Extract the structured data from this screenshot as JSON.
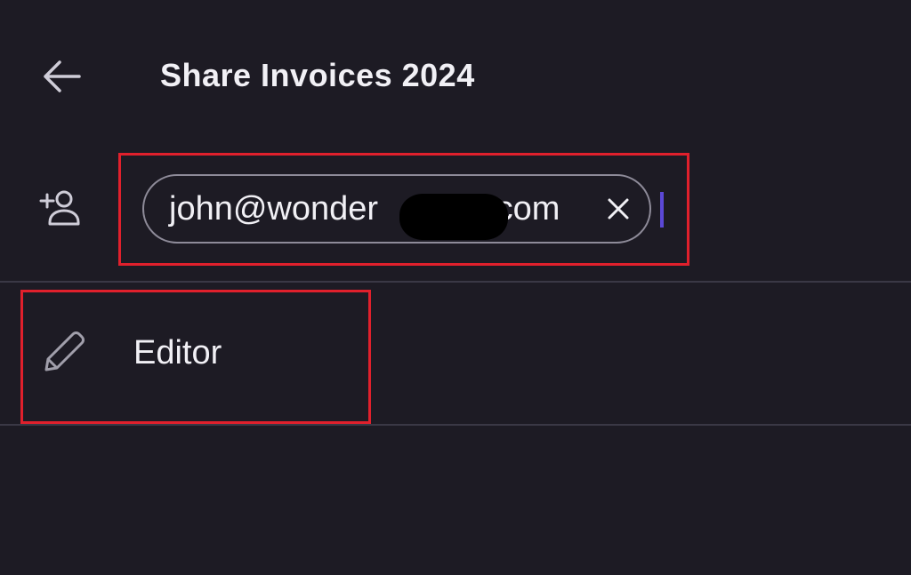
{
  "header": {
    "title": "Share Invoices 2024",
    "back_icon": "arrow-left-icon"
  },
  "recipients": {
    "add_icon": "add-person-icon",
    "chips": [
      {
        "label": "john@wonder▮▮▮▮.com",
        "visible_prefix": "john@wonder",
        "visible_suffix": ".com",
        "remove_icon": "close-icon"
      }
    ]
  },
  "permission": {
    "icon": "pencil-icon",
    "label": "Editor"
  },
  "colors": {
    "background": "#1d1b24",
    "text": "#f1f0f5",
    "chip_border": "#8e8b99",
    "cursor": "#5b48d6",
    "highlight": "#e0202c",
    "divider": "#3a3845"
  }
}
